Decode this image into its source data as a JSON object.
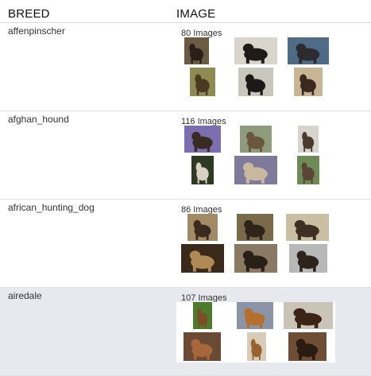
{
  "table": {
    "headers": {
      "breed": "BREED",
      "image": "IMAGE"
    },
    "rows": [
      {
        "breed": "affenpinscher",
        "count": "80 Images",
        "thumbs": [
          {
            "bg": "#6b5a44",
            "fg": "#2a2019"
          },
          {
            "bg": "#d9d4cc",
            "fg": "#1e1b18"
          },
          {
            "bg": "#4f6b86",
            "fg": "#2d2b30"
          },
          {
            "bg": "#8e8a52",
            "fg": "#4a3a22"
          },
          {
            "bg": "#c9c6bd",
            "fg": "#1c1a18"
          },
          {
            "bg": "#c8b596",
            "fg": "#3b2a1d"
          }
        ]
      },
      {
        "breed": "afghan_hound",
        "count": "116 Images",
        "thumbs": [
          {
            "bg": "#7c6fb0",
            "fg": "#3a2b22"
          },
          {
            "bg": "#8f9b7d",
            "fg": "#6b5640"
          },
          {
            "bg": "#d7d4ce",
            "fg": "#4a3b31"
          },
          {
            "bg": "#2f3a25",
            "fg": "#d8d2c4"
          },
          {
            "bg": "#7f7a9b",
            "fg": "#c9b79e"
          },
          {
            "bg": "#6e8a56",
            "fg": "#5a4536"
          }
        ]
      },
      {
        "breed": "african_hunting_dog",
        "count": "86 Images",
        "thumbs": [
          {
            "bg": "#a38a66",
            "fg": "#3a2b1e"
          },
          {
            "bg": "#7a6a4a",
            "fg": "#2e2419"
          },
          {
            "bg": "#cbbfa3",
            "fg": "#3d2f22"
          },
          {
            "bg": "#3a2a1a",
            "fg": "#b08a55"
          },
          {
            "bg": "#8b7a63",
            "fg": "#2a1f17"
          },
          {
            "bg": "#b8b8b8",
            "fg": "#2e241b"
          }
        ]
      },
      {
        "breed": "airedale",
        "count": "107 Images",
        "thumbs": [
          {
            "bg": "#4e7a2e",
            "fg": "#7a4f25"
          },
          {
            "bg": "#8a94a6",
            "fg": "#b5702d"
          },
          {
            "bg": "#c9c3b8",
            "fg": "#3b2415"
          },
          {
            "bg": "#6b4a35",
            "fg": "#a7673a"
          },
          {
            "bg": "#d7ccb8",
            "fg": "#9a6230"
          },
          {
            "bg": "#6f4e36",
            "fg": "#2a1b12"
          }
        ]
      }
    ]
  }
}
